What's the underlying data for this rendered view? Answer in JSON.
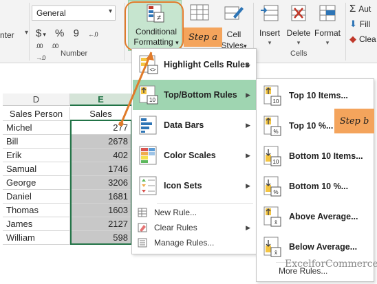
{
  "ribbon": {
    "enter_fragment": "nter",
    "number_format": "General",
    "number_buttons": [
      "$",
      "%",
      "9"
    ],
    "number_group_label": "Number",
    "cells_group_label": "Cells",
    "conditional_formatting": {
      "line1": "Conditional",
      "line2": "Formatting"
    },
    "cell_styles": {
      "line1": "Cell",
      "line2": "Styles"
    },
    "insert_label": "Insert",
    "delete_label": "Delete",
    "format_label": "Format",
    "editing": {
      "autosum": "Aut",
      "fill": "Fill",
      "clear": "Clea"
    }
  },
  "sheet": {
    "col_d": "D",
    "col_e": "E",
    "headers": {
      "person": "Sales Person",
      "sales": "Sales"
    },
    "rows": [
      {
        "name": "Michel",
        "sales": "277"
      },
      {
        "name": "Bill",
        "sales": "2678"
      },
      {
        "name": "Erik",
        "sales": "402"
      },
      {
        "name": "Samual",
        "sales": "1746"
      },
      {
        "name": "George",
        "sales": "3206"
      },
      {
        "name": "Daniel",
        "sales": "1681"
      },
      {
        "name": "Thomas",
        "sales": "1603"
      },
      {
        "name": "James",
        "sales": "2127"
      },
      {
        "name": "William",
        "sales": "598"
      }
    ]
  },
  "cf_menu": {
    "items": [
      {
        "label": "Highlight Cells Rules",
        "icon": "highlight-cells-icon"
      },
      {
        "label": "Top/Bottom Rules",
        "icon": "top-bottom-icon",
        "active": true
      },
      {
        "label": "Data Bars",
        "icon": "data-bars-icon"
      },
      {
        "label": "Color Scales",
        "icon": "color-scales-icon"
      },
      {
        "label": "Icon Sets",
        "icon": "icon-sets-icon"
      }
    ],
    "new_rule": "New Rule...",
    "clear_rules": "Clear Rules",
    "manage_rules": "Manage Rules..."
  },
  "submenu": {
    "items": [
      {
        "label": "Top 10 Items...",
        "badge": "10"
      },
      {
        "label": "Top 10 %...",
        "badge": "%"
      },
      {
        "label": "Bottom 10 Items...",
        "badge": "10"
      },
      {
        "label": "Bottom 10 %...",
        "badge": "%"
      },
      {
        "label": "Above Average...",
        "badge": "x̄"
      },
      {
        "label": "Below Average...",
        "badge": "x̄"
      }
    ],
    "more_rules": "More Rules..."
  },
  "callouts": {
    "step_a": "Step a",
    "step_b": "Step b"
  },
  "watermark": "ExcelforCommerce",
  "colors": {
    "accent_green": "#217346",
    "menu_highlight": "#9fd5b1",
    "callout_orange": "#f4a45c",
    "arrow_orange": "#e07b2a"
  }
}
